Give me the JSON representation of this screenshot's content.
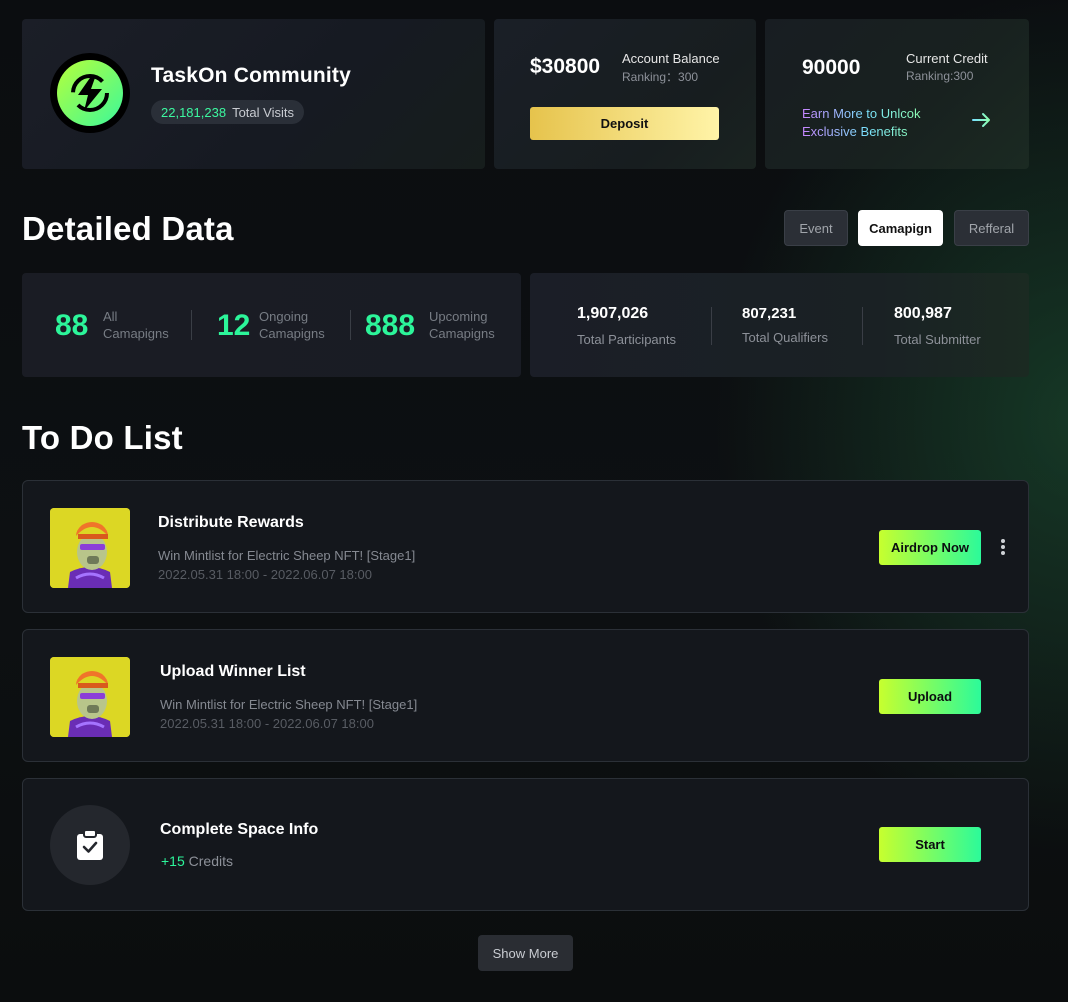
{
  "community": {
    "name": "TaskOn Community",
    "visits_count": "22,181,238",
    "visits_label": "Total Visits",
    "logo_icon": "lightning-bolt-icon"
  },
  "balance": {
    "amount": "$30800",
    "label": "Account Balance",
    "ranking": "Ranking：300",
    "deposit_label": "Deposit"
  },
  "credit": {
    "amount": "90000",
    "label": "Current Credit",
    "ranking": "Ranking:300",
    "earn_line1": "Earn More to Unlcok",
    "earn_line2": "Exclusive Benefits",
    "arrow_icon": "arrow-right-icon"
  },
  "detailed": {
    "title": "Detailed Data",
    "tabs": [
      {
        "label": "Event",
        "active": false
      },
      {
        "label": "Camapign",
        "active": true
      },
      {
        "label": "Refferal",
        "active": false
      }
    ]
  },
  "campaign_stats": [
    {
      "value": "88",
      "label_line1": "All",
      "label_line2": "Camapigns"
    },
    {
      "value": "12",
      "label_line1": "Ongoing",
      "label_line2": "Camapigns"
    },
    {
      "value": "888",
      "label_line1": "Upcoming",
      "label_line2": "Camapigns"
    }
  ],
  "participant_stats": [
    {
      "value": "1,907,026",
      "label": "Total Participants"
    },
    {
      "value": "807,231",
      "label": "Total Qualifiers"
    },
    {
      "value": "800,987",
      "label": "Total Submitter"
    }
  ],
  "todo": {
    "title": "To Do List",
    "items": [
      {
        "title": "Distribute Rewards",
        "subtitle": "Win Mintlist for Electric Sheep NFT!  [Stage1]",
        "date": "2022.05.31  18:00 - 2022.06.07  18:00",
        "action": "Airdrop Now"
      },
      {
        "title": "Upload Winner List",
        "subtitle": "Win Mintlist for Electric Sheep NFT!  [Stage1]",
        "date": "2022.05.31  18:00 - 2022.06.07  18:00",
        "action": "Upload"
      },
      {
        "title": "Complete Space Info",
        "credits_plus": "+15",
        "credits_label": "Credits",
        "action": "Start",
        "icon": "clipboard-check-icon"
      }
    ],
    "show_more": "Show More"
  },
  "colors": {
    "accent_green": "#2cf59a",
    "lime": "#c7ff2e",
    "gold": "#e6c34c"
  }
}
